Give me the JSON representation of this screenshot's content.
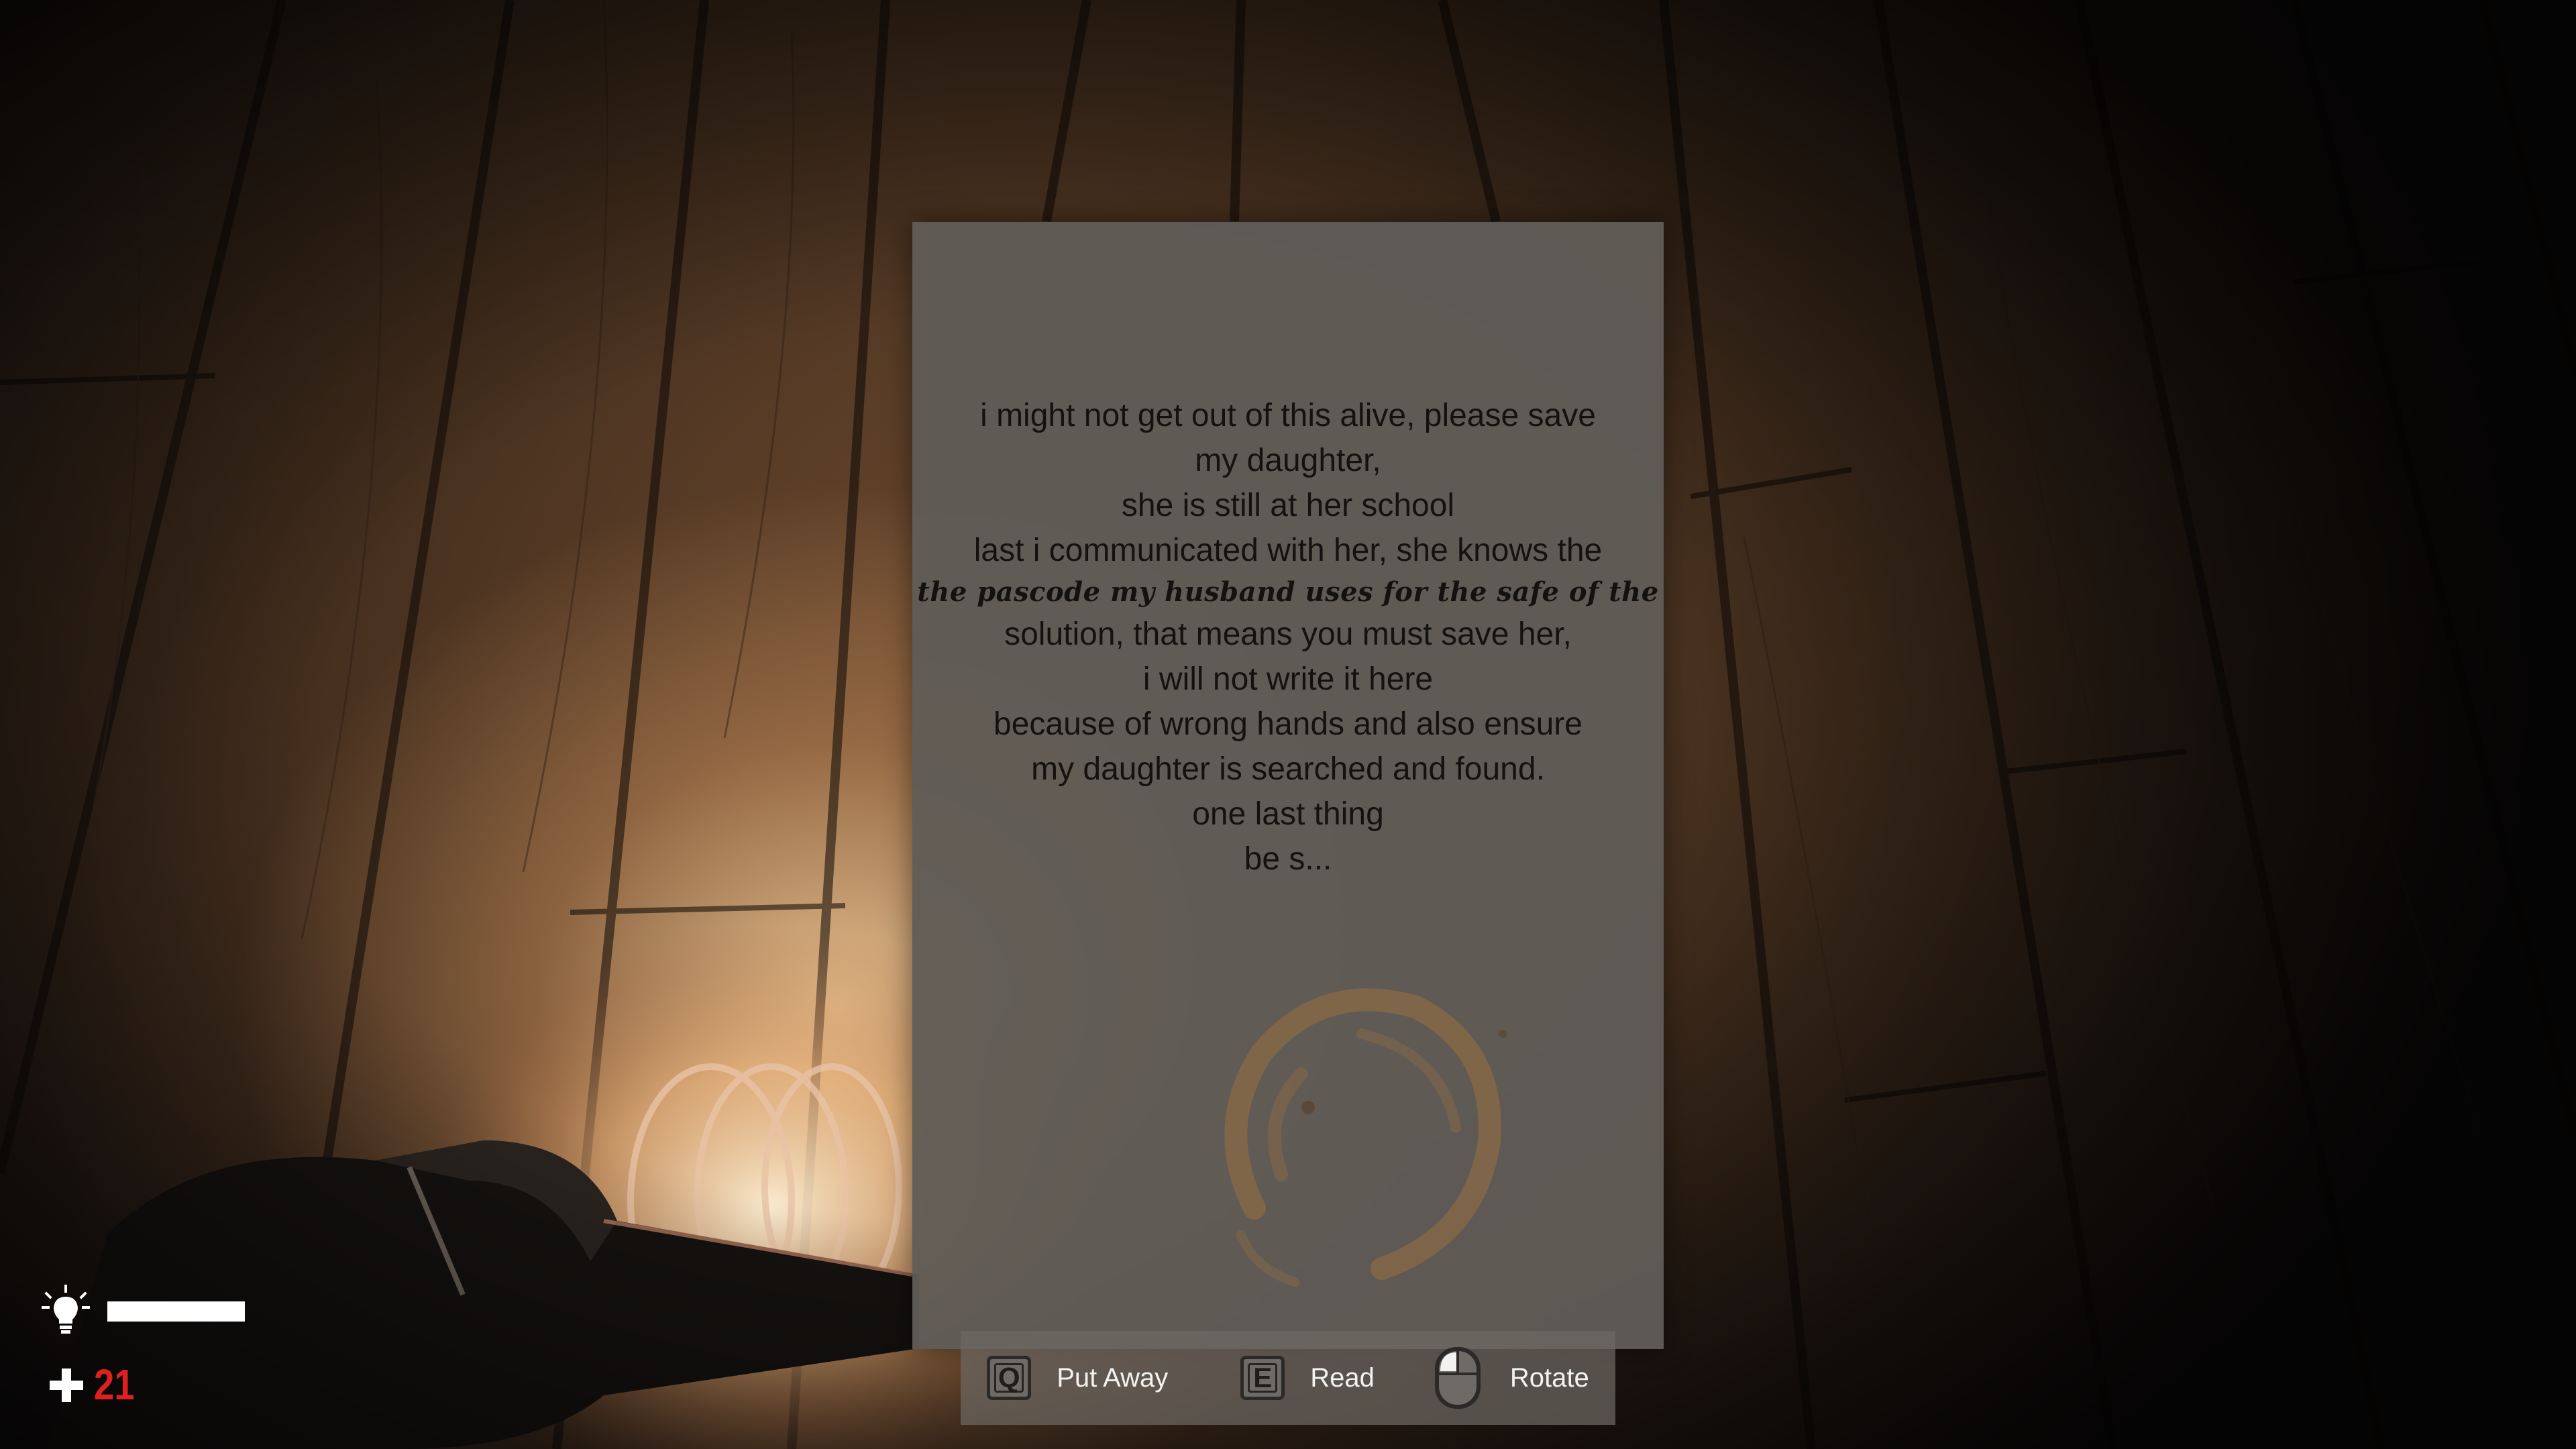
{
  "note": {
    "lines": [
      "i might not get out of this alive, please save",
      "my daughter,",
      "she is still at her school",
      "last i communicated with her, she knows the",
      "the pascode my husband uses for the safe of the",
      "solution, that means you must save her,",
      "i will not write it here",
      "because of wrong hands and also ensure",
      "my daughter is searched and found.",
      "one last thing",
      "be s..."
    ]
  },
  "prompts": {
    "put_away": {
      "key": "Q",
      "label": "Put Away"
    },
    "read": {
      "key": "E",
      "label": "Read"
    },
    "rotate": {
      "label": "Rotate"
    }
  },
  "hud": {
    "light_level": 0.57,
    "health": "21"
  },
  "colors": {
    "health": "#e02020",
    "light_bar": "#ffffff"
  }
}
